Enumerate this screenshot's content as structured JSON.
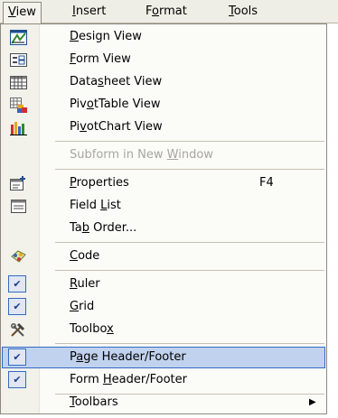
{
  "menubar": {
    "items": [
      {
        "pre": "",
        "key": "V",
        "post": "iew"
      },
      {
        "pre": "",
        "key": "I",
        "post": "nsert"
      },
      {
        "pre": "F",
        "key": "o",
        "post": "rmat"
      },
      {
        "pre": "",
        "key": "T",
        "post": "ools"
      }
    ]
  },
  "menu": {
    "design_view": {
      "pre": "",
      "key": "D",
      "post": "esign View"
    },
    "form_view": {
      "pre": "",
      "key": "F",
      "post": "orm View"
    },
    "datasheet_view": {
      "pre": "Data",
      "key": "s",
      "post": "heet View"
    },
    "pivottable_view": {
      "pre": "Piv",
      "key": "o",
      "post": "tTable View"
    },
    "pivotchart_view": {
      "pre": "Pi",
      "key": "v",
      "post": "otChart View"
    },
    "subform_new_window": {
      "pre": "Subform in New ",
      "key": "W",
      "post": "indow"
    },
    "properties": {
      "pre": "",
      "key": "P",
      "post": "roperties",
      "shortcut": "F4"
    },
    "field_list": {
      "pre": "Field ",
      "key": "L",
      "post": "ist"
    },
    "tab_order": {
      "pre": "Ta",
      "key": "b",
      "post": " Order..."
    },
    "code": {
      "pre": "",
      "key": "C",
      "post": "ode"
    },
    "ruler": {
      "pre": "",
      "key": "R",
      "post": "uler"
    },
    "grid": {
      "pre": "",
      "key": "G",
      "post": "rid"
    },
    "toolbox": {
      "pre": "Toolbo",
      "key": "x",
      "post": ""
    },
    "page_header_footer": {
      "pre": "P",
      "key": "a",
      "post": "ge Header/Footer"
    },
    "form_header_footer": {
      "pre": "Form ",
      "key": "H",
      "post": "eader/Footer"
    },
    "toolbars": {
      "pre": "",
      "key": "T",
      "post": "oolbars"
    }
  },
  "colors": {
    "highlight": "#c1d2ee",
    "highlight_border": "#316ac5",
    "disabled_text": "#a7a69f"
  }
}
